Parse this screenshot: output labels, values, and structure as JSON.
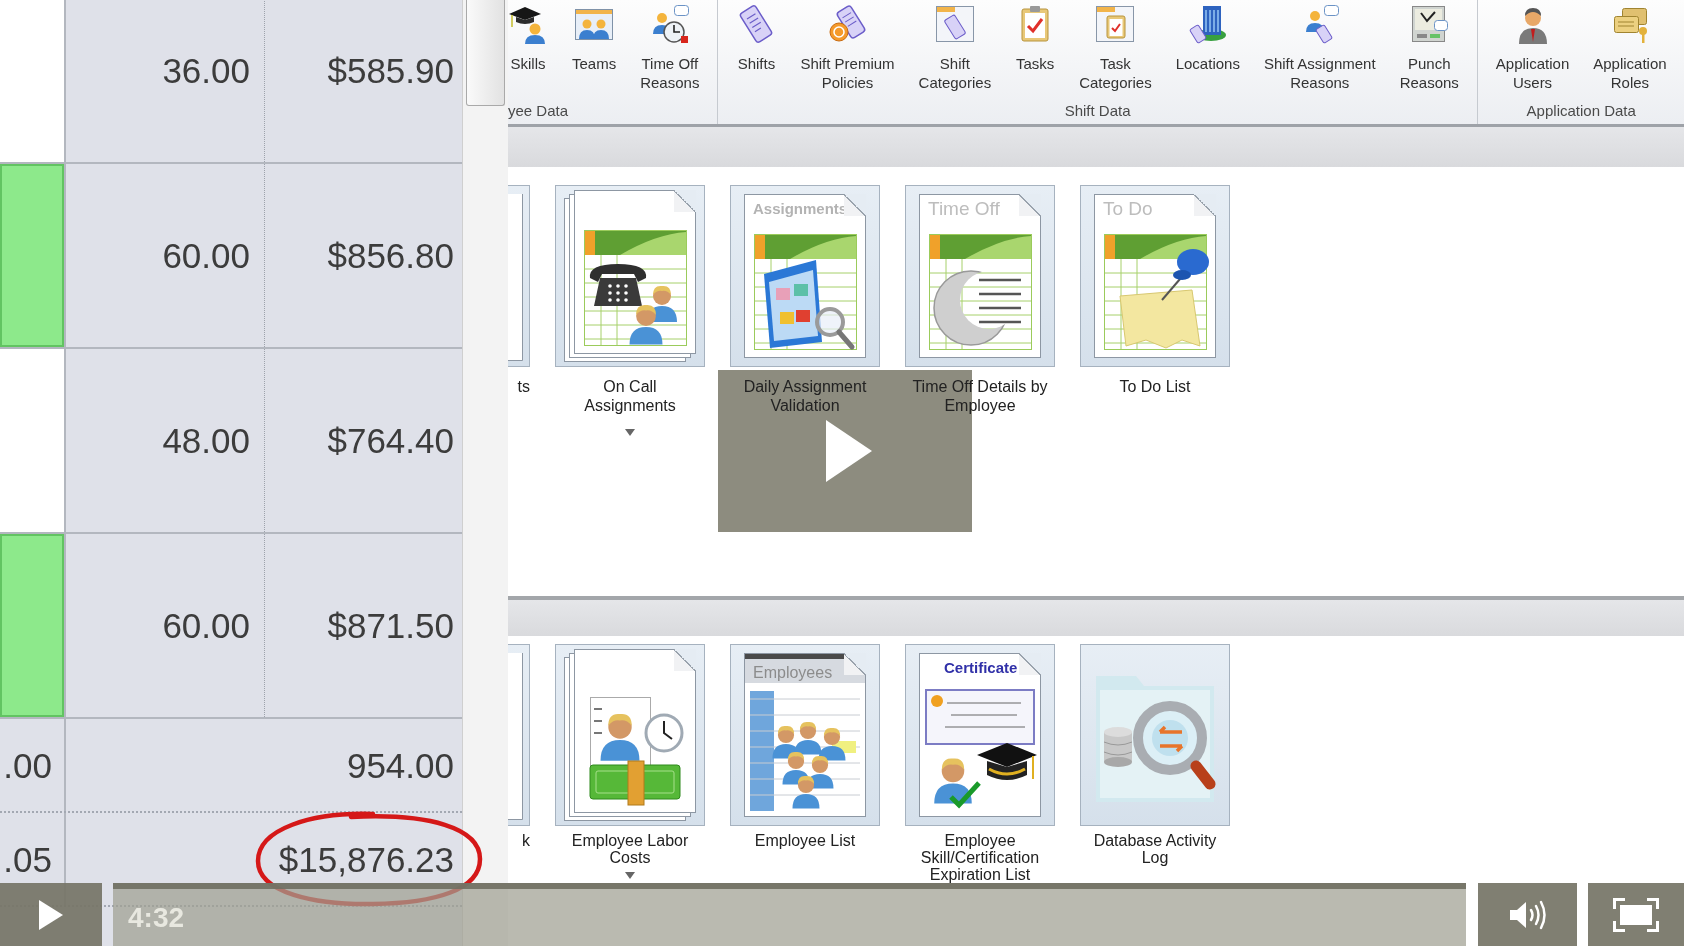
{
  "zoomed_table": {
    "rows": [
      {
        "kind": "data",
        "highlighted": false,
        "circled": false,
        "column_2": "36.00",
        "column_3": "$585.90"
      },
      {
        "kind": "data",
        "highlighted": true,
        "circled": false,
        "column_2": "60.00",
        "column_3": "$856.80"
      },
      {
        "kind": "data",
        "highlighted": false,
        "circled": false,
        "column_2": "48.00",
        "column_3": "$764.40"
      },
      {
        "kind": "data",
        "highlighted": true,
        "circled": false,
        "column_2": "60.00",
        "column_3": "$871.50"
      },
      {
        "kind": "total",
        "highlighted": false,
        "circled": false,
        "column_1": ".00",
        "column_3": "954.00"
      },
      {
        "kind": "total",
        "highlighted": false,
        "circled": true,
        "column_1": ".05",
        "column_3": "$15,876.23"
      }
    ]
  },
  "ribbon": {
    "groups": [
      {
        "label": "yee Data",
        "items": [
          {
            "kind": "mortarboard",
            "label": "Skills"
          },
          {
            "kind": "team",
            "label": "Teams"
          },
          {
            "kind": "timeoff",
            "label": "Time Off\nReasons"
          }
        ]
      },
      {
        "label": "Shift Data",
        "items": [
          {
            "kind": "scroll",
            "label": "Shifts"
          },
          {
            "kind": "coin",
            "label": "Shift Premium\nPolicies"
          },
          {
            "kind": "scrollwindow",
            "label": "Shift\nCategories"
          },
          {
            "kind": "clipboard",
            "label": "Tasks"
          },
          {
            "kind": "clipwindow",
            "label": "Task\nCategories"
          },
          {
            "kind": "building",
            "label": "Locations"
          },
          {
            "kind": "assignee",
            "label": "Shift Assignment\nReasons"
          },
          {
            "kind": "punch",
            "label": "Punch\nReasons"
          }
        ]
      },
      {
        "label": "Application Data",
        "items": [
          {
            "kind": "user",
            "label": "Application\nUsers"
          },
          {
            "kind": "roles",
            "label": "Application\nRoles"
          }
        ]
      }
    ]
  },
  "reports": {
    "sections": [
      {
        "tiles": [
          {
            "kind": "cut",
            "label": "ts",
            "expandable": false
          },
          {
            "kind": "phone",
            "label": "On Call\nAssignments",
            "expandable": true
          },
          {
            "kind": "assignments",
            "caption": "Assignments",
            "label": "Daily Assignment\nValidation",
            "expandable": false
          },
          {
            "kind": "timeoff",
            "caption": "Time Off",
            "label": "Time Off Details by\nEmployee",
            "expandable": false
          },
          {
            "kind": "todo",
            "caption": "To Do",
            "label": "To Do List",
            "expandable": false
          }
        ]
      },
      {
        "tiles": [
          {
            "kind": "cut",
            "label": "k",
            "expandable": false
          },
          {
            "kind": "labor",
            "label": "Employee Labor\nCosts",
            "expandable": true
          },
          {
            "kind": "employees",
            "caption": "Employees",
            "label": "Employee List",
            "expandable": false
          },
          {
            "kind": "certificate",
            "caption": "Certificate",
            "label": "Employee\nSkill/Certification\nExpiration List",
            "expandable": false
          },
          {
            "kind": "database",
            "label": "Database Activity\nLog",
            "expandable": false
          }
        ]
      }
    ]
  },
  "player": {
    "paused": true,
    "time": "4:32"
  }
}
